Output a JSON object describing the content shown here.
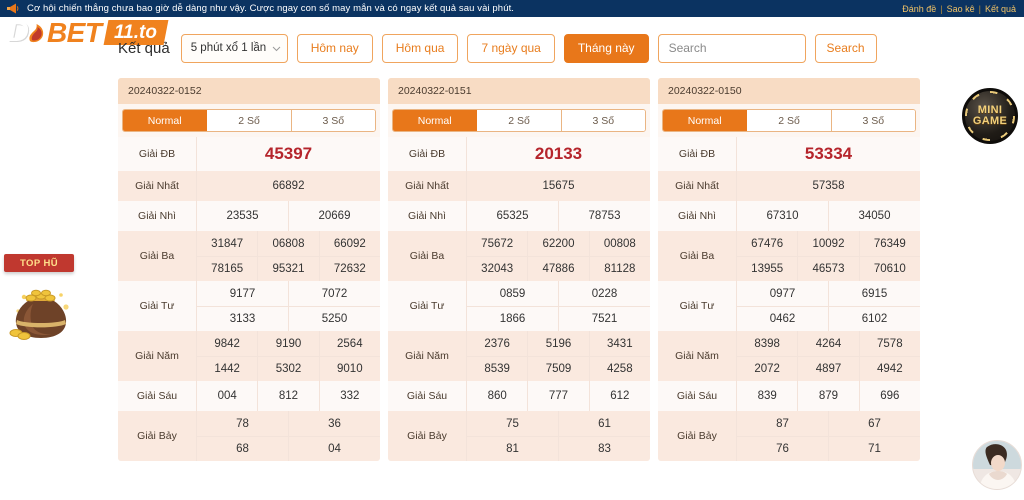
{
  "announcement": {
    "icon": "megaphone-icon",
    "text": "Cơ hội chiến thắng chưa bao giờ dễ dàng như vậy. Cược ngay con số may mắn và có ngay kết quả sau vài phút.",
    "links": [
      "Đánh đề",
      "Sao kê",
      "Kết quả"
    ],
    "separator": "|",
    "bg_color": "#0b3361",
    "link_color": "#f0c266"
  },
  "logo": {
    "part1": "D",
    "flame_icon": "flame-icon",
    "part2": "BET",
    "tag": "11.to",
    "accent_color": "#f0821e"
  },
  "toolbar": {
    "label": "Kết quả",
    "select": {
      "value": "5 phút xổ 1 lần",
      "chevron_icon": "chevron-down-icon"
    },
    "buttons": [
      {
        "label": "Hôm nay",
        "active": false
      },
      {
        "label": "Hôm qua",
        "active": false
      },
      {
        "label": "7 ngày qua",
        "active": false
      },
      {
        "label": "Tháng này",
        "active": true
      }
    ],
    "search": {
      "placeholder": "Search",
      "value": "",
      "button_label": "Search"
    },
    "accent_color": "#e8771a"
  },
  "cards": [
    {
      "id": "20240322-0152",
      "tabs": [
        {
          "label": "Normal",
          "active": true
        },
        {
          "label": "2 Số",
          "active": false
        },
        {
          "label": "3 Số",
          "active": false
        }
      ],
      "prizes": [
        {
          "label": "Giải ĐB",
          "lines": [
            [
              "45397"
            ]
          ]
        },
        {
          "label": "Giải Nhất",
          "lines": [
            [
              "66892"
            ]
          ]
        },
        {
          "label": "Giải Nhì",
          "lines": [
            [
              "23535",
              "20669"
            ]
          ]
        },
        {
          "label": "Giải Ba",
          "lines": [
            [
              "31847",
              "06808",
              "66092"
            ],
            [
              "78165",
              "95321",
              "72632"
            ]
          ]
        },
        {
          "label": "Giải Tư",
          "lines": [
            [
              "9177",
              "7072"
            ],
            [
              "3133",
              "5250"
            ]
          ]
        },
        {
          "label": "Giải Năm",
          "lines": [
            [
              "9842",
              "9190",
              "2564"
            ],
            [
              "1442",
              "5302",
              "9010"
            ]
          ]
        },
        {
          "label": "Giải Sáu",
          "lines": [
            [
              "004",
              "812",
              "332"
            ]
          ]
        },
        {
          "label": "Giải Bảy",
          "lines": [
            [
              "78",
              "36"
            ],
            [
              "68",
              "04"
            ]
          ]
        }
      ]
    },
    {
      "id": "20240322-0151",
      "tabs": [
        {
          "label": "Normal",
          "active": true
        },
        {
          "label": "2 Số",
          "active": false
        },
        {
          "label": "3 Số",
          "active": false
        }
      ],
      "prizes": [
        {
          "label": "Giải ĐB",
          "lines": [
            [
              "20133"
            ]
          ]
        },
        {
          "label": "Giải Nhất",
          "lines": [
            [
              "15675"
            ]
          ]
        },
        {
          "label": "Giải Nhì",
          "lines": [
            [
              "65325",
              "78753"
            ]
          ]
        },
        {
          "label": "Giải Ba",
          "lines": [
            [
              "75672",
              "62200",
              "00808"
            ],
            [
              "32043",
              "47886",
              "81128"
            ]
          ]
        },
        {
          "label": "Giải Tư",
          "lines": [
            [
              "0859",
              "0228"
            ],
            [
              "1866",
              "7521"
            ]
          ]
        },
        {
          "label": "Giải Năm",
          "lines": [
            [
              "2376",
              "5196",
              "3431"
            ],
            [
              "8539",
              "7509",
              "4258"
            ]
          ]
        },
        {
          "label": "Giải Sáu",
          "lines": [
            [
              "860",
              "777",
              "612"
            ]
          ]
        },
        {
          "label": "Giải Bảy",
          "lines": [
            [
              "75",
              "61"
            ],
            [
              "81",
              "83"
            ]
          ]
        }
      ]
    },
    {
      "id": "20240322-0150",
      "tabs": [
        {
          "label": "Normal",
          "active": true
        },
        {
          "label": "2 Số",
          "active": false
        },
        {
          "label": "3 Số",
          "active": false
        }
      ],
      "prizes": [
        {
          "label": "Giải ĐB",
          "lines": [
            [
              "53334"
            ]
          ]
        },
        {
          "label": "Giải Nhất",
          "lines": [
            [
              "57358"
            ]
          ]
        },
        {
          "label": "Giải Nhì",
          "lines": [
            [
              "67310",
              "34050"
            ]
          ]
        },
        {
          "label": "Giải Ba",
          "lines": [
            [
              "67476",
              "10092",
              "76349"
            ],
            [
              "13955",
              "46573",
              "70610"
            ]
          ]
        },
        {
          "label": "Giải Tư",
          "lines": [
            [
              "0977",
              "6915"
            ],
            [
              "0462",
              "6102"
            ]
          ]
        },
        {
          "label": "Giải Năm",
          "lines": [
            [
              "8398",
              "4264",
              "7578"
            ],
            [
              "2072",
              "4897",
              "4942"
            ]
          ]
        },
        {
          "label": "Giải Sáu",
          "lines": [
            [
              "839",
              "879",
              "696"
            ]
          ]
        },
        {
          "label": "Giải Bảy",
          "lines": [
            [
              "87",
              "67"
            ],
            [
              "76",
              "71"
            ]
          ]
        }
      ]
    }
  ],
  "widgets": {
    "minigame": {
      "line1": "MINI",
      "line2": "GAME",
      "icon": "poker-chip-icon"
    },
    "tophu": {
      "label": "TOP HŨ",
      "icon": "money-bag-icon"
    },
    "avatar": {
      "icon": "avatar-icon"
    }
  },
  "theme": {
    "prize_highlight_color": "#b5252c",
    "row_odd_bg": "#fdf9f7",
    "row_even_bg": "#fae9df",
    "card_header_bg": "#f8dcc4"
  }
}
